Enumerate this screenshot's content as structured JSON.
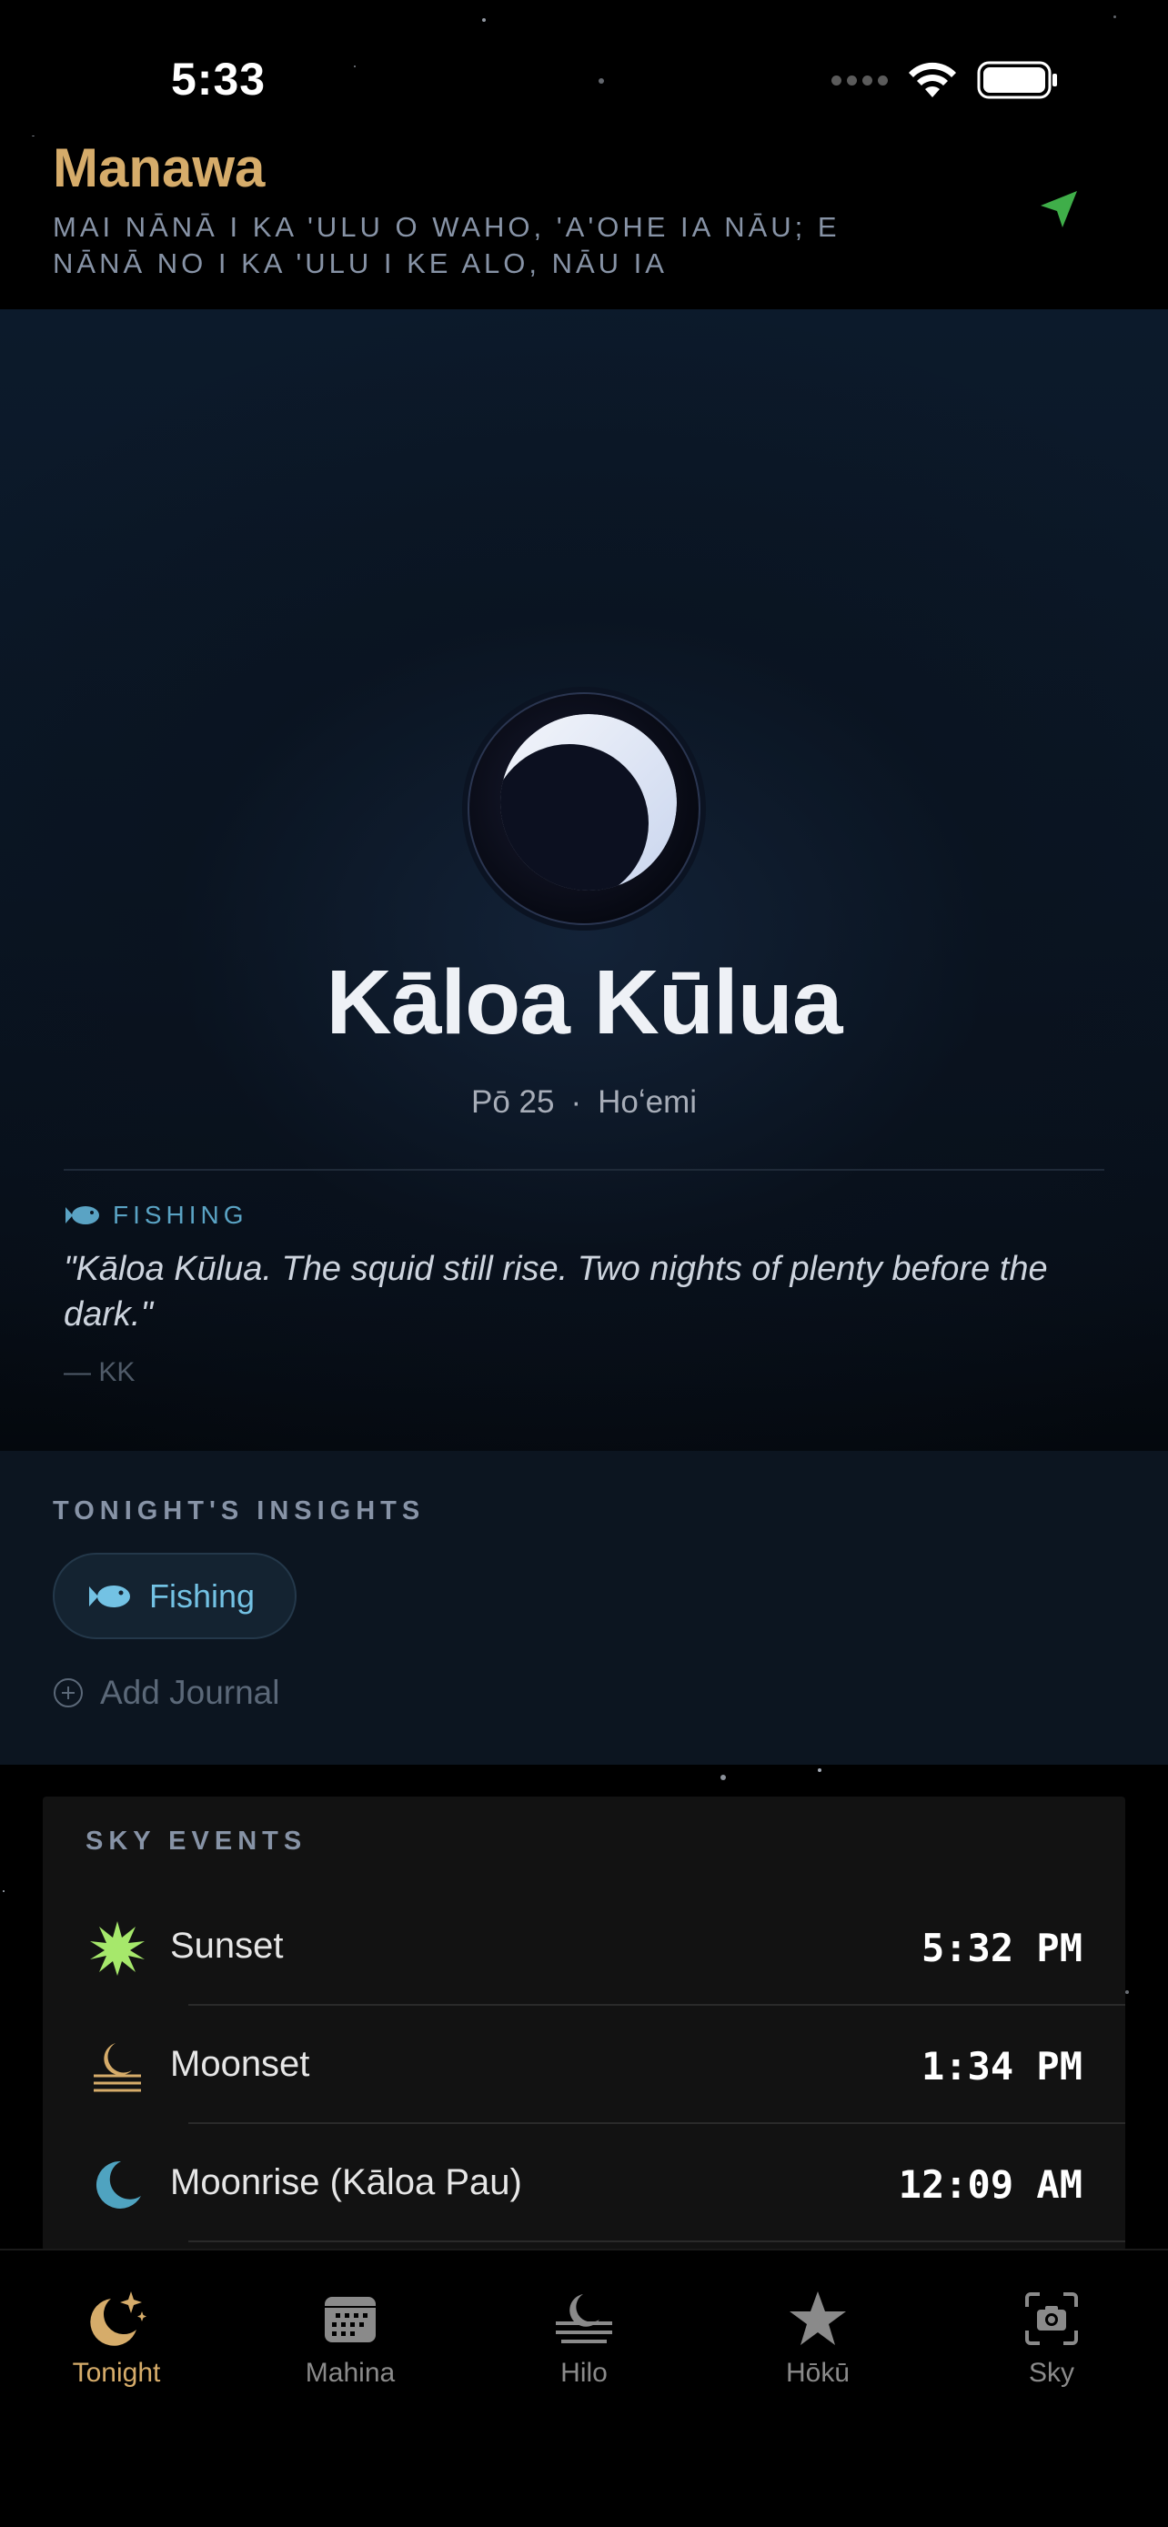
{
  "status_bar": {
    "time": "5:33"
  },
  "header": {
    "title": "Manawa",
    "subtitle": "MAI NĀNĀ I KA 'ULU O WAHO, 'A'OHE IA NĀU; E NĀNĀ NO I KA 'ULU I KE ALO, NĀU IA",
    "location_icon": "location-arrow-icon"
  },
  "moon": {
    "phase_name": "Kāloa Kūlua",
    "night": "Pō 25",
    "separator": "·",
    "season": "Hoʻemi"
  },
  "quote": {
    "category": "FISHING",
    "text": "\"Kāloa Kūlua. The squid still rise. Two nights of plenty before the dark.\"",
    "author": "— KK"
  },
  "insights": {
    "title": "TONIGHT'S INSIGHTS",
    "chips": [
      {
        "label": "Fishing",
        "icon": "fish-icon"
      }
    ],
    "add_journal": "Add Journal"
  },
  "sky_events": {
    "title": "SKY EVENTS",
    "events": [
      {
        "name": "Sunset",
        "time": "5:32 PM",
        "icon": "sunset-icon",
        "color": "#a6e86b"
      },
      {
        "name": "Moonset",
        "time": "1:34 PM",
        "icon": "moonset-icon",
        "color": "#d6ac6a"
      },
      {
        "name": "Moonrise (Kāloa Pau)",
        "time": "12:09 AM",
        "icon": "moonrise-icon",
        "color": "#4fa3c0"
      }
    ]
  },
  "tabs": [
    {
      "label": "Tonight",
      "icon": "moon-stars-icon",
      "active": true
    },
    {
      "label": "Mahina",
      "icon": "calendar-icon",
      "active": false
    },
    {
      "label": "Hilo",
      "icon": "moon-horizon-icon",
      "active": false
    },
    {
      "label": "Hōkū",
      "icon": "star-icon",
      "active": false
    },
    {
      "label": "Sky",
      "icon": "camera-viewfinder-icon",
      "active": false
    }
  ],
  "colors": {
    "accent_gold": "#d6ac6a",
    "accent_blue": "#5aa3c4",
    "location_green": "#3fae49"
  }
}
